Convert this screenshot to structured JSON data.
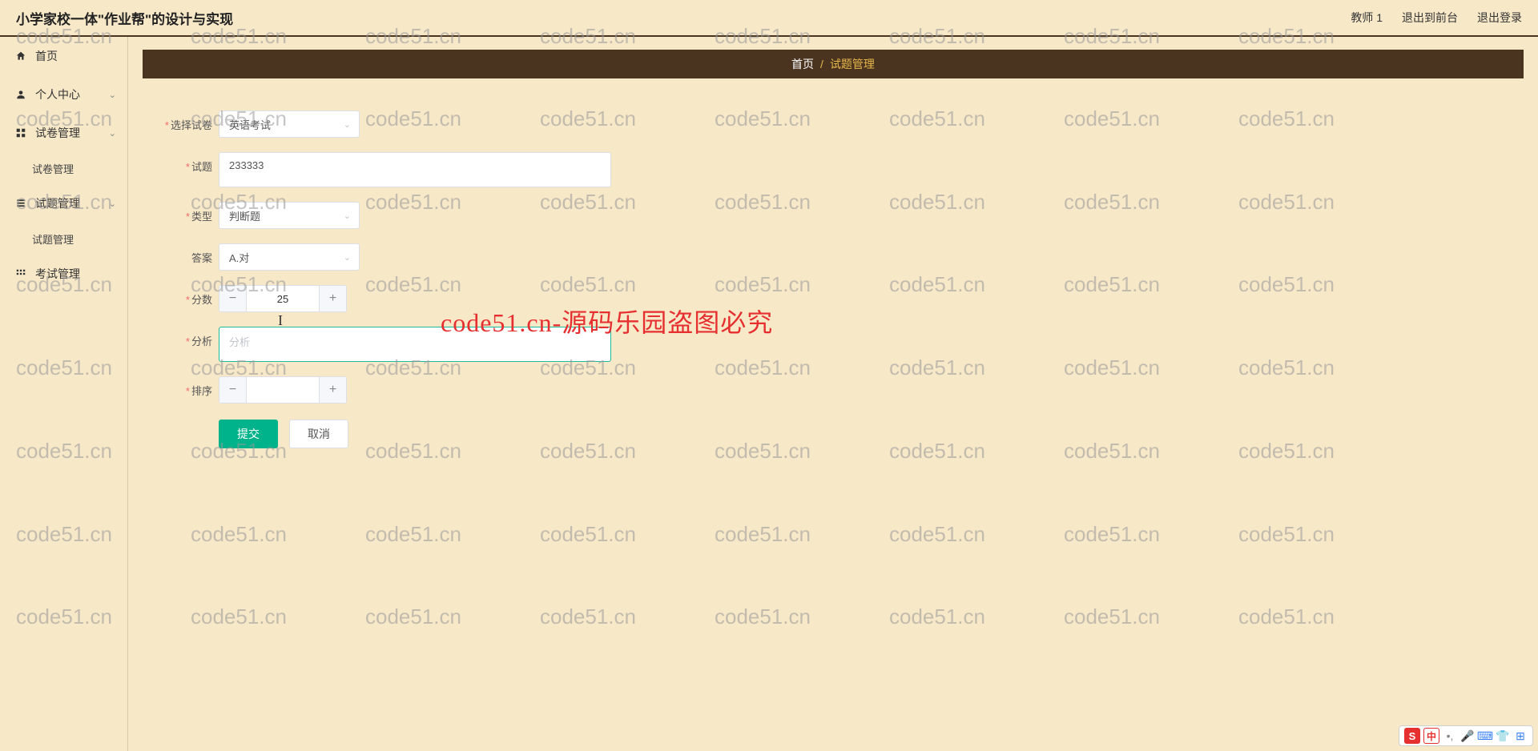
{
  "header": {
    "title": "小学家校一体\"作业帮\"的设计与实现",
    "user": "教师 1",
    "logout_front": "退出到前台",
    "logout": "退出登录"
  },
  "sidebar": {
    "home": "首页",
    "personal": "个人中心",
    "exam_mgmt": "试卷管理",
    "exam_mgmt_sub": "试卷管理",
    "question_mgmt": "试题管理",
    "question_mgmt_sub": "试题管理",
    "test_mgmt": "考试管理"
  },
  "breadcrumb": {
    "home": "首页",
    "sep": "/",
    "current": "试题管理"
  },
  "form": {
    "select_exam_label": "选择试卷",
    "select_exam_value": "英语考试",
    "question_label": "试题",
    "question_value": "233333",
    "type_label": "类型",
    "type_value": "判断题",
    "answer_label": "答案",
    "answer_value": "A.对",
    "score_label": "分数",
    "score_value": "25",
    "analysis_label": "分析",
    "analysis_placeholder": "分析",
    "sort_label": "排序",
    "sort_value": "",
    "submit_btn": "提交",
    "cancel_btn": "取消"
  },
  "watermark_text": "code51.cn",
  "center_watermark": "code51.cn-源码乐园盗图必究",
  "ime": {
    "logo": "S",
    "lang": "中"
  }
}
